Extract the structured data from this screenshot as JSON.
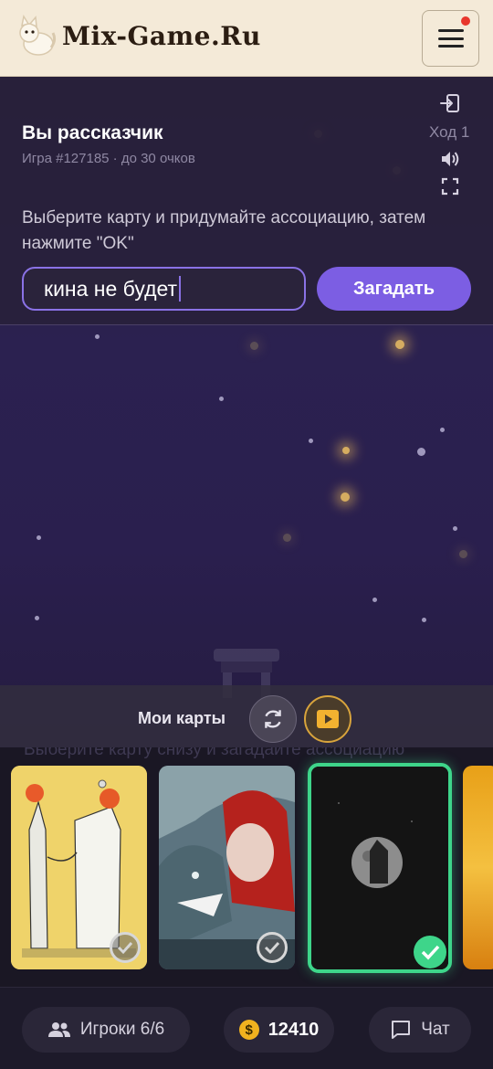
{
  "header": {
    "logo_text": "Mix-Game.Ru"
  },
  "game": {
    "role_title": "Вы рассказчик",
    "game_subtitle": "Игра #127185 · до 30 очков",
    "turn_label": "Ход 1",
    "instruction": "Выберите карту и придумайте ассоциацию, затем нажмите \"OK\"",
    "association_value": "кина не будет",
    "guess_button": "Загадать",
    "hand_label": "Мои карты",
    "ghost_hint": "Выберите карту снизу и загадайте ассоциацию"
  },
  "cards": [
    {
      "name": "card-doctors",
      "selected": false
    },
    {
      "name": "card-red-riding-hood",
      "selected": false
    },
    {
      "name": "card-moon",
      "selected": true
    },
    {
      "name": "card-yellow-partial",
      "selected": false
    }
  ],
  "bottom": {
    "players_label": "Игроки 6/6",
    "coins": "12410",
    "coin_symbol": "$",
    "chat_label": "Чат"
  },
  "icons": {
    "menu": "hamburger-icon",
    "exit": "exit-icon",
    "sound": "speaker-icon",
    "fullscreen": "fullscreen-icon",
    "refresh": "refresh-icon",
    "video": "video-play-icon",
    "players": "users-icon",
    "coin": "coin-icon",
    "chat": "chat-icon"
  },
  "colors": {
    "accent": "#7c5ee3",
    "selected_card": "#3ed58a",
    "notification": "#e8362c",
    "coin": "#f1b21f"
  }
}
